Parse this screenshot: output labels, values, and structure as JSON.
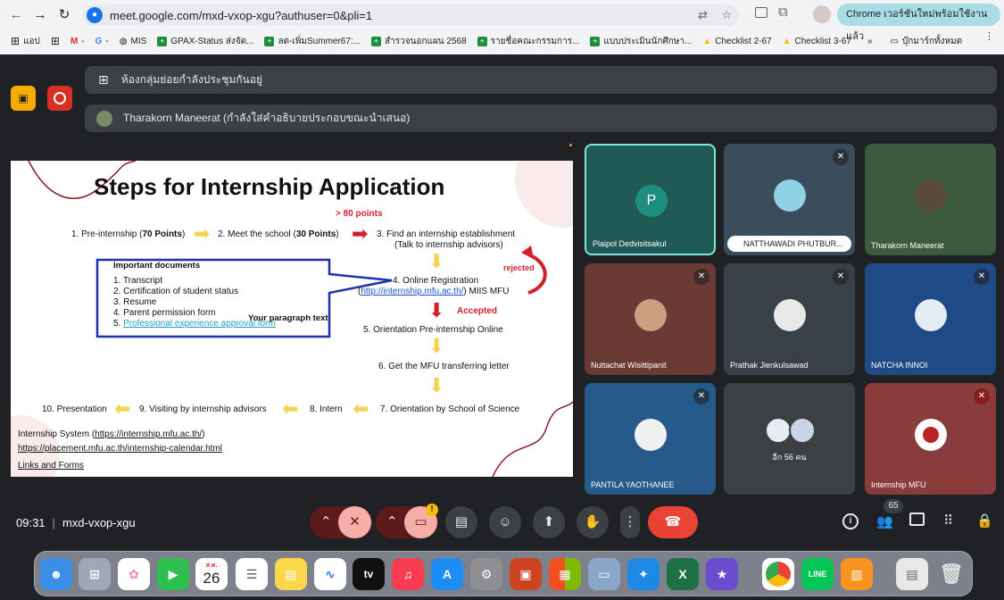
{
  "browser": {
    "url": "meet.google.com/mxd-vxop-xgu?authuser=0&pli=1",
    "update_label": "Chrome เวอร์ชันใหม่พร้อมใช้งานแล้ว"
  },
  "bookmarks": {
    "items": [
      "แอป",
      "MIS",
      "GPAX-Status ส่งจัด...",
      "ลด-เพิ่มSummer67:...",
      "สำรวจนอกแผน 2568",
      "รายชื่อคณะกรรมการ...",
      "แบบประเมินนักศึกษา...",
      "Checklist 2-67",
      "Checklist 3-67"
    ],
    "folder": "บุ๊กมาร์กทั้งหมด"
  },
  "meet": {
    "breakout_banner": "ห้องกลุ่มย่อยกำลังประชุมกันอยู่",
    "presenter_banner": "Tharakorn Maneerat (กำลังใส่คำอธิบายประกอบขณะนำเสนอ)",
    "participants": [
      {
        "name": "Plaipol Dedvisitsakul",
        "initial": "P",
        "muted": false
      },
      {
        "name": "NATTHAWADI PHUTBUR...",
        "muted": true
      },
      {
        "name": "Tharakorn Maneerat",
        "muted": false
      },
      {
        "name": "Nuttachat Wisittipanit",
        "muted": true
      },
      {
        "name": "Prathak Jienkulsawad",
        "muted": true
      },
      {
        "name": "NATCHA INNOI",
        "muted": true
      },
      {
        "name": "PANTILA YAOTHANEE",
        "muted": true
      },
      {
        "name": "อีก 56 คน",
        "muted": false
      },
      {
        "name": "Internship MFU",
        "muted": true
      }
    ],
    "time": "09:31",
    "code": "mxd-vxop-xgu",
    "people_count": "65"
  },
  "slide": {
    "title": "Steps for Internship Application",
    "points_note": "> 80 points",
    "step1": "1. Pre-internship (",
    "step1b": "70 Points",
    "step1c": ")",
    "step2": "2. Meet the school (",
    "step2b": "30 Points",
    "step2c": ")",
    "step3": "3. Find an internship establishment",
    "step3b": "(Talk to internship advisors)",
    "rejected": "rejected",
    "step4": "4. Online Registration",
    "step4_link": "http://internship.mfu.ac.th/",
    "step4_tail": ") MIIS MFU",
    "step4_open": "(",
    "accepted": "Accepted",
    "step5": "5. Orientation Pre-internship Online",
    "step6": "6. Get the MFU transferring letter",
    "step7": "7. Orientation by School of Science",
    "step8": "8. Intern",
    "step9": "9. Visiting by internship advisors",
    "step10": "10. Presentation",
    "docs_title": "Important documents",
    "docs": [
      "1. Transcript",
      "2. Certification of student status",
      "3. Resume",
      "4. Parent permission form"
    ],
    "doc5_prefix": "5. ",
    "doc5_link": "Professional experience approval form",
    "annotation": "Your paragraph text",
    "sys_label": "Internship System (",
    "sys_link": "https://internship.mfu.ac.th/",
    "sys_close": ")",
    "calendar_link": "https://placement.mfu.ac.th/internship-calendar.html",
    "links_forms": "Links and Forms"
  },
  "dock": {
    "calendar_month": "ส.ค.",
    "calendar_day": "26",
    "tv_label": "tv"
  }
}
